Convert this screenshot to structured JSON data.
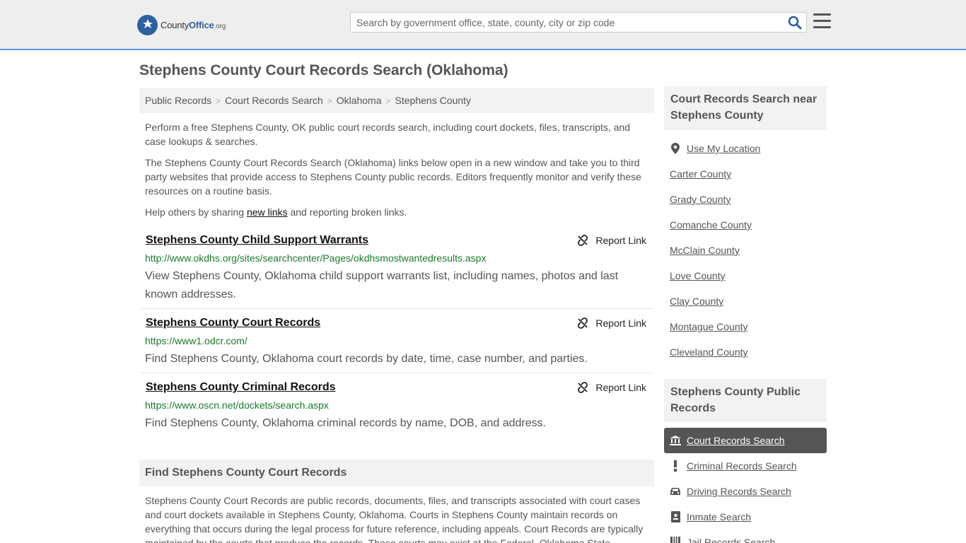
{
  "header": {
    "logo_main": "County",
    "logo_bold": "Office",
    "logo_tld": ".org",
    "search_placeholder": "Search by government office, state, county, city or zip code"
  },
  "page": {
    "title": "Stephens County Court Records Search (Oklahoma)"
  },
  "breadcrumb": [
    "Public Records",
    "Court Records Search",
    "Oklahoma",
    "Stephens County"
  ],
  "intro": {
    "p1": "Perform a free Stephens County, OK public court records search, including court dockets, files, transcripts, and case lookups & searches.",
    "p2": "The Stephens County Court Records Search (Oklahoma) links below open in a new window and take you to third party websites that provide access to Stephens County public records. Editors frequently monitor and verify these resources on a routine basis.",
    "p3_before": "Help others by sharing ",
    "p3_link": "new links",
    "p3_after": " and reporting broken links."
  },
  "report_label": "Report Link",
  "entries": [
    {
      "title": "Stephens County Child Support Warrants",
      "url": "http://www.okdhs.org/sites/searchcenter/Pages/okdhsmostwantedresults.aspx",
      "desc": "View Stephens County, Oklahoma child support warrants list, including names, photos and last known addresses."
    },
    {
      "title": "Stephens County Court Records",
      "url": "https://www1.odcr.com/",
      "desc": "Find Stephens County, Oklahoma court records by date, time, case number, and parties."
    },
    {
      "title": "Stephens County Criminal Records",
      "url": "https://www.oscn.net/dockets/search.aspx",
      "desc": "Find Stephens County, Oklahoma criminal records by name, DOB, and address."
    }
  ],
  "find_section": {
    "heading": "Find Stephens County Court Records",
    "body": "Stephens County Court Records are public records, documents, files, and transcripts associated with court cases and court dockets available in Stephens County, Oklahoma. Courts in Stephens County maintain records on everything that occurs during the legal process for future reference, including appeals. Court Records are typically maintained by the courts that produce the records. These courts may exist at the Federal, Oklahoma State"
  },
  "sidebar": {
    "nearby_heading": "Court Records Search near Stephens County",
    "use_location": "Use My Location",
    "nearby": [
      "Carter County",
      "Grady County",
      "Comanche County",
      "McClain County",
      "Love County",
      "Clay County",
      "Montague County",
      "Cleveland County"
    ],
    "public_heading": "Stephens County Public Records",
    "public_items": [
      {
        "label": "Court Records Search",
        "icon": "courthouse-icon",
        "active": true
      },
      {
        "label": "Criminal Records Search",
        "icon": "exclamation-icon",
        "active": false
      },
      {
        "label": "Driving Records Search",
        "icon": "car-icon",
        "active": false
      },
      {
        "label": "Inmate Search",
        "icon": "id-card-icon",
        "active": false
      },
      {
        "label": "Jail Records Search",
        "icon": "jail-icon",
        "active": false
      }
    ]
  },
  "colors": {
    "accent_border": "#5596d6",
    "link_green": "#1a7a2c",
    "active_bg": "#555555"
  }
}
